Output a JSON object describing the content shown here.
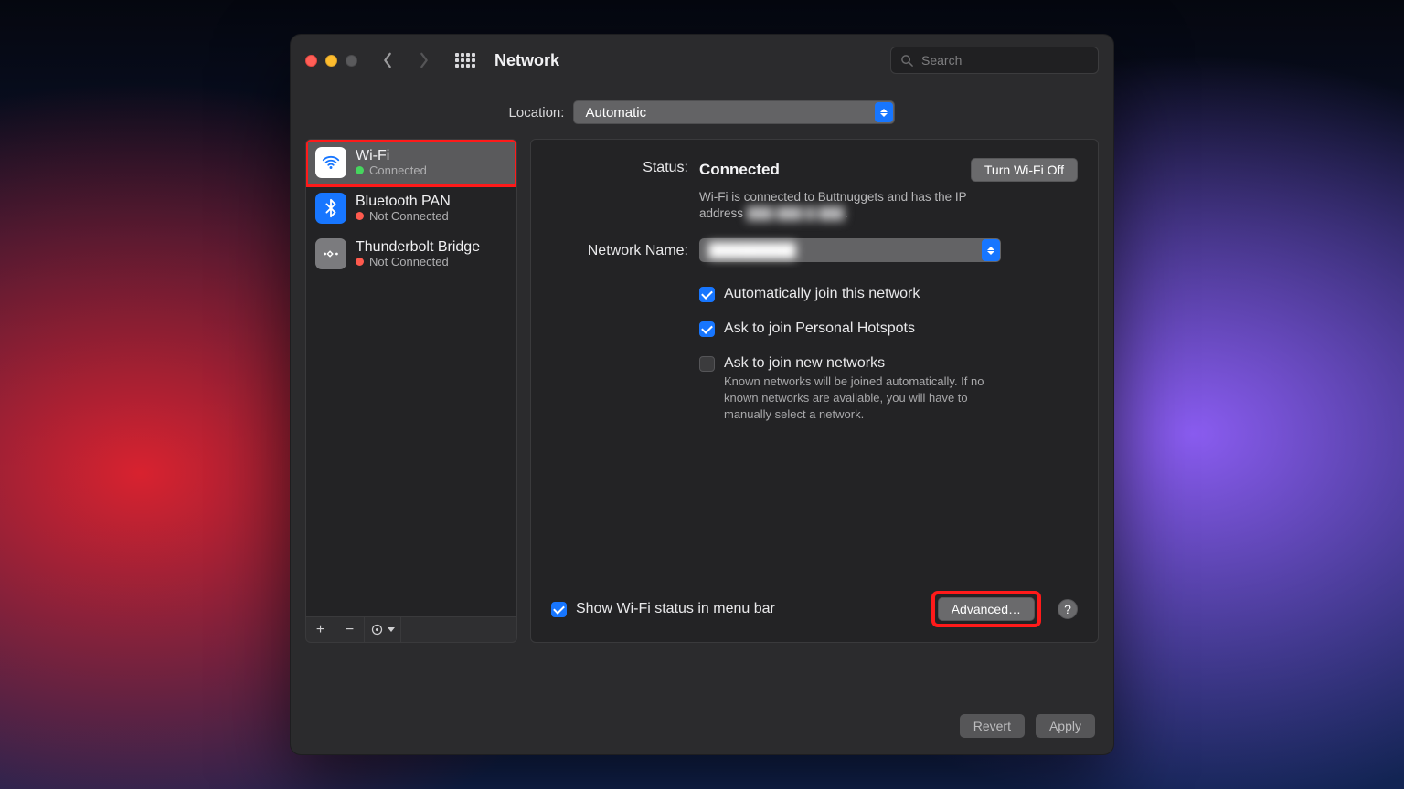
{
  "titlebar": {
    "title": "Network",
    "search_placeholder": "Search"
  },
  "location": {
    "label": "Location:",
    "value": "Automatic"
  },
  "sidebar": {
    "services": [
      {
        "name": "Wi-Fi",
        "status": "Connected",
        "status_color": "green",
        "icon": "wifi",
        "selected": true,
        "highlight": true
      },
      {
        "name": "Bluetooth PAN",
        "status": "Not Connected",
        "status_color": "red",
        "icon": "bt",
        "selected": false,
        "highlight": false
      },
      {
        "name": "Thunderbolt Bridge",
        "status": "Not Connected",
        "status_color": "red",
        "icon": "tb",
        "selected": false,
        "highlight": false
      }
    ],
    "toolbar": {
      "add": "+",
      "remove": "−",
      "more": "⊙"
    }
  },
  "main": {
    "status_label": "Status:",
    "status_value": "Connected",
    "toggle_button": "Turn Wi-Fi Off",
    "status_desc_prefix": "Wi-Fi is connected to Buttnuggets and has the IP address ",
    "status_desc_ip": "███.███.█.███",
    "network_name_label": "Network Name:",
    "network_name_value": "█████████",
    "checkboxes": {
      "auto_join": {
        "checked": true,
        "label": "Automatically join this network"
      },
      "hotspots": {
        "checked": true,
        "label": "Ask to join Personal Hotspots"
      },
      "new_networks": {
        "checked": false,
        "label": "Ask to join new networks"
      }
    },
    "new_networks_desc": "Known networks will be joined automatically. If no known networks are available, you will have to manually select a network.",
    "show_status_label": "Show Wi-Fi status in menu bar",
    "show_status_checked": true,
    "advanced_button": "Advanced…",
    "help": "?"
  },
  "bottom": {
    "revert": "Revert",
    "apply": "Apply"
  }
}
